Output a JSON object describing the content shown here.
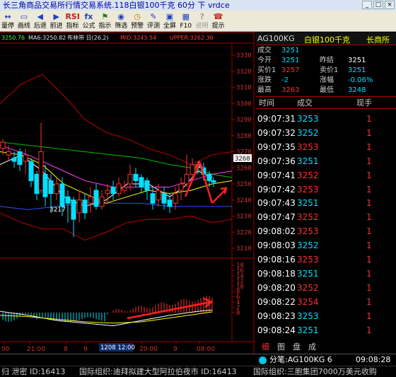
{
  "window": {
    "title": "长三角商品交易所行情交易系统.118白银100千克 60分 下 vrdce",
    "buttons": [
      "_",
      "□",
      "×"
    ]
  },
  "toolbar": [
    {
      "icon": "↔",
      "label": "量停"
    },
    {
      "icon": "▭",
      "label": "画线"
    },
    {
      "icon": "◀",
      "label": "后退"
    },
    {
      "icon": "▶",
      "label": "前进"
    },
    {
      "icon": "RSI",
      "label": "指标"
    },
    {
      "icon": "fx",
      "label": "公式"
    },
    {
      "icon": "⚑",
      "label": "指示"
    },
    {
      "icon": "◉",
      "label": "筛选"
    },
    {
      "icon": "◷",
      "label": "预警"
    },
    {
      "icon": "✎",
      "label": "评测"
    },
    {
      "icon": "▣",
      "label": "全屏"
    },
    {
      "icon": "▦",
      "label": "F10"
    },
    {
      "icon": "?",
      "label": "说明",
      "disabled": true
    },
    {
      "icon": "☎",
      "label": "提示"
    }
  ],
  "indicator_header": {
    "value1": "3250.76",
    "ma6": "MA6:3250.82",
    "boll": "布林带 日(26,2)",
    "mid": "MID:3243.54",
    "upper": "UPPER:3262.36"
  },
  "price_axis": [
    "3330",
    "3320",
    "3310",
    "3300",
    "3290",
    "3280",
    "3270",
    "3260",
    "3250",
    "3240",
    "3230",
    "3220",
    "3210"
  ],
  "price_badge": "3268",
  "low_label": "3217",
  "macd_axis": [
    "18",
    "16",
    "14",
    "12",
    "10",
    "8",
    "6",
    "4",
    "2",
    "0"
  ],
  "time_axis": {
    "labels": [
      "00",
      "21:00",
      "8",
      "9",
      "12",
      "20:00",
      "9",
      "08:00"
    ],
    "cursor_label": "1208 12:00"
  },
  "quote": {
    "code": "AG100KG",
    "name": "白银100千克",
    "exchange": "长商所",
    "rows": [
      {
        "l1": "成交",
        "v1": "3251",
        "c1": "cyan"
      },
      {
        "l1": "今开",
        "v1": "3251",
        "c1": "cyan",
        "l2": "昨结",
        "v2": "3251",
        "c2": "white"
      },
      {
        "l1": "买价1",
        "v1": "3257",
        "c1": "red",
        "l2": "卖价1",
        "v2": "3251",
        "c2": "cyan"
      },
      {
        "l1": "涨跌",
        "v1": "-2",
        "c1": "cyan",
        "l2": "涨幅",
        "v2": "-0.06%",
        "c2": "cyan"
      },
      {
        "l1": "最高",
        "v1": "3263",
        "c1": "red",
        "l2": "最低",
        "v2": "3248",
        "c2": "cyan"
      }
    ]
  },
  "ticks_header": {
    "time": "时间",
    "price": "成交",
    "vol": "现手"
  },
  "ticks": [
    {
      "time": "09:07:31",
      "price": "3253",
      "color": "cyan",
      "vol": "1"
    },
    {
      "time": "09:07:32",
      "price": "3252",
      "color": "cyan",
      "vol": "1"
    },
    {
      "time": "09:07:35",
      "price": "3253",
      "color": "red",
      "vol": "1"
    },
    {
      "time": "09:07:36",
      "price": "3251",
      "color": "cyan",
      "vol": "1"
    },
    {
      "time": "09:07:41",
      "price": "3252",
      "color": "red",
      "vol": "1"
    },
    {
      "time": "09:07:42",
      "price": "3253",
      "color": "red",
      "vol": "1"
    },
    {
      "time": "09:07:43",
      "price": "3251",
      "color": "cyan",
      "vol": "1"
    },
    {
      "time": "09:07:47",
      "price": "3252",
      "color": "red",
      "vol": "1"
    },
    {
      "time": "09:08:02",
      "price": "3253",
      "color": "red",
      "vol": "1"
    },
    {
      "time": "09:08:03",
      "price": "3252",
      "color": "cyan",
      "vol": "1"
    },
    {
      "time": "09:08:16",
      "price": "3253",
      "color": "red",
      "vol": "1"
    },
    {
      "time": "09:08:18",
      "price": "3251",
      "color": "cyan",
      "vol": "1"
    },
    {
      "time": "09:08:20",
      "price": "3252",
      "color": "red",
      "vol": "1"
    },
    {
      "time": "09:08:22",
      "price": "3254",
      "color": "red",
      "vol": "1"
    },
    {
      "time": "09:08:23",
      "price": "3253",
      "color": "cyan",
      "vol": "1"
    },
    {
      "time": "09:08:24",
      "price": "3251",
      "color": "cyan",
      "vol": "1"
    }
  ],
  "panel_tabs": [
    "细",
    "图",
    "盘",
    "成"
  ],
  "status": {
    "stock": "分笔:AG100KG 6",
    "clock": "09:08:28"
  },
  "news": {
    "item1": "归 泄密 ID:16413",
    "item2": "国际组织:迪拜拟建大型阿拉伯夜市 ID:16413",
    "item3": "国际组织:三胞集团7000万美元收购"
  },
  "colors": {
    "up": "#ff3030",
    "down": "#00e0ff",
    "ma_white": "#ffffff",
    "ma_yellow": "#ffff00",
    "ma_green": "#00c000",
    "ma_magenta": "#ff40ff",
    "boll_band": "#c00000",
    "mid_line": "#3050ff",
    "arrow": "#ff2020"
  }
}
